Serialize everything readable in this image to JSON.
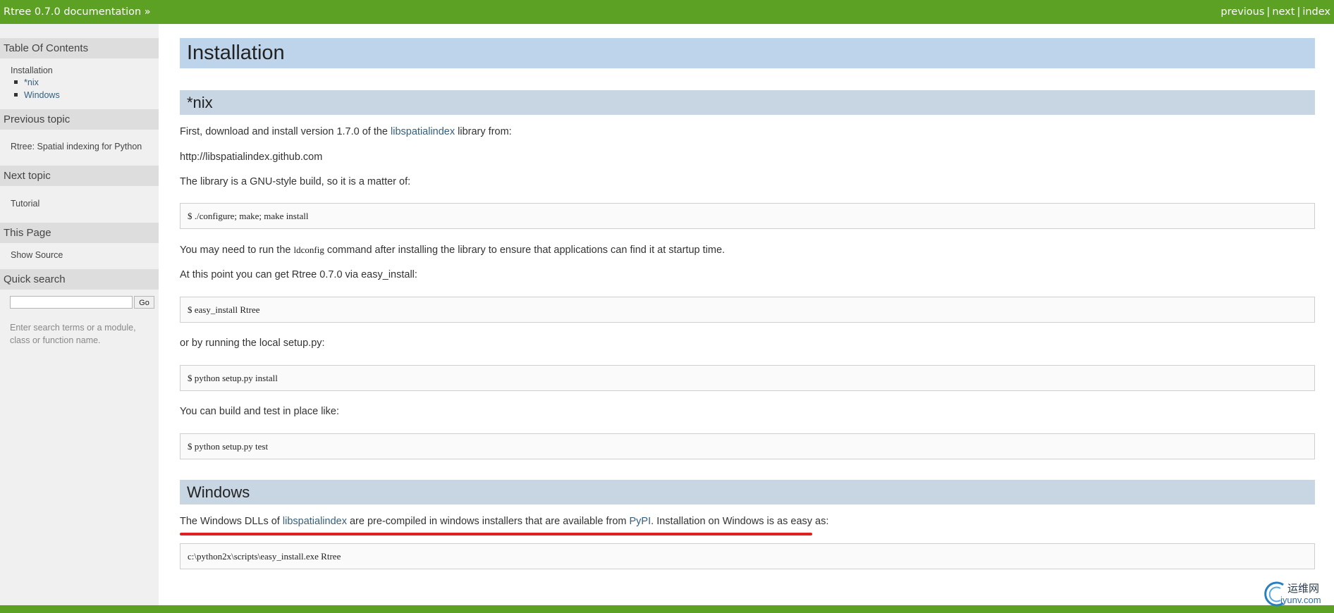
{
  "topbar": {
    "doc_title": "Rtree 0.7.0 documentation »",
    "nav": {
      "previous": "previous",
      "next": "next",
      "index": "index",
      "separator": "|"
    }
  },
  "sidebar": {
    "toc_heading": "Table Of Contents",
    "toc": {
      "installation": "Installation",
      "items": [
        "*nix",
        "Windows"
      ]
    },
    "prev_heading": "Previous topic",
    "prev_link": "Rtree: Spatial indexing for Python",
    "next_heading": "Next topic",
    "next_link": "Tutorial",
    "this_page_heading": "This Page",
    "show_source": "Show Source",
    "search_heading": "Quick search",
    "search_value": "",
    "go_label": "Go",
    "search_hint": "Enter search terms or a module, class or function name."
  },
  "main": {
    "title": "Installation",
    "nix": {
      "heading": "*nix",
      "p1_before": "First, download and install version 1.7.0 of the ",
      "p1_link": "libspatialindex",
      "p1_after": " library from:",
      "url": "http://libspatialindex.github.com",
      "p2": "The library is a GNU-style build, so it is a matter of:",
      "code1": "$ ./configure; make; make install",
      "p3_before": "You may need to run the ",
      "p3_code": "ldconfig",
      "p3_after": " command after installing the library to ensure that applications can find it at startup time.",
      "p4": "At this point you can get Rtree 0.7.0 via easy_install:",
      "code2": "$ easy_install Rtree",
      "p5": "or by running the local setup.py:",
      "code3": "$ python setup.py install",
      "p6": "You can build and test in place like:",
      "code4": "$ python setup.py test"
    },
    "windows": {
      "heading": "Windows",
      "p1_before": "The Windows DLLs of ",
      "p1_link1": "libspatialindex",
      "p1_mid": " are pre-compiled in windows installers that are available from ",
      "p1_link2": "PyPI",
      "p1_after": ". Installation on Windows is as easy as:",
      "code1": "c:\\python2x\\scripts\\easy_install.exe Rtree"
    }
  },
  "watermark": {
    "line1": "运维网",
    "line2": "iyunv.com"
  },
  "colors": {
    "topbar": "#5ca124",
    "h1_bg": "#bed4eb",
    "h2_bg": "#c8d5e3",
    "sidebar_bg": "#f0f0f0",
    "sidebar_heading_bg": "#dddddd",
    "link": "#355f7c",
    "annotation": "#e02020"
  }
}
